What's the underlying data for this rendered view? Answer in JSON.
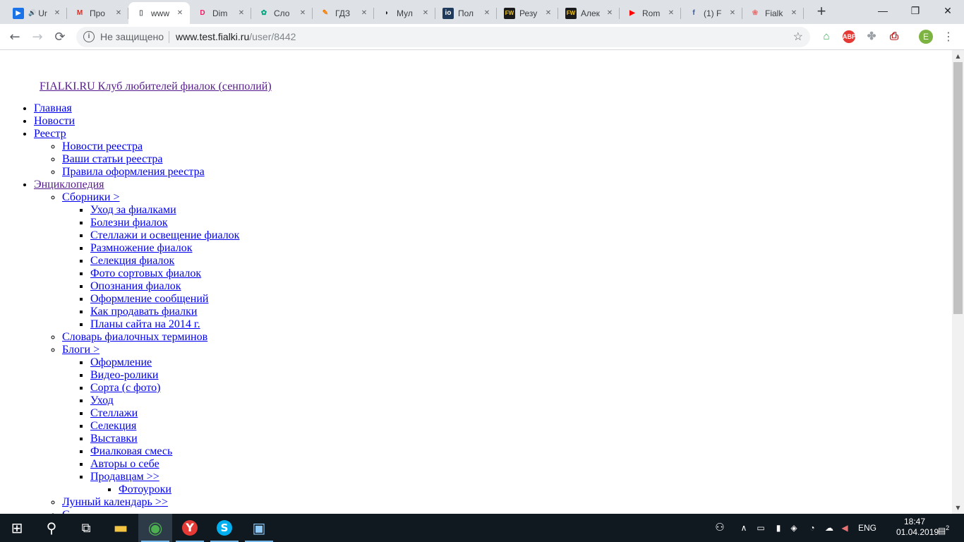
{
  "browser": {
    "tabs": [
      {
        "title": "Ur",
        "icon": "video-play-icon",
        "color": "#1a73e8",
        "glyph": "▶",
        "audio": true
      },
      {
        "title": "Про",
        "icon": "gmail-icon",
        "color": "#d93025",
        "glyph": "M"
      },
      {
        "title": "www",
        "icon": "page-icon",
        "color": "#5f6368",
        "glyph": "▯",
        "active": true
      },
      {
        "title": "Dim",
        "icon": "dim-icon",
        "color": "#e91e63",
        "glyph": "D"
      },
      {
        "title": "Сло",
        "icon": "slo-icon",
        "color": "#00a67e",
        "glyph": "✿"
      },
      {
        "title": "ГДЗ",
        "icon": "pencil-icon",
        "color": "#f57c00",
        "glyph": "✎"
      },
      {
        "title": "Мул",
        "icon": "mul-icon",
        "color": "#202124",
        "glyph": "◗"
      },
      {
        "title": "Пол",
        "icon": "io-icon",
        "color": "#1f3a5a",
        "glyph": "io"
      },
      {
        "title": "Резу",
        "icon": "fw-icon",
        "color": "#1b1b1b",
        "glyph": "FW"
      },
      {
        "title": "Алек",
        "icon": "fw-icon",
        "color": "#1b1b1b",
        "glyph": "FW"
      },
      {
        "title": "Rom",
        "icon": "youtube-icon",
        "color": "#ff0000",
        "glyph": "▶"
      },
      {
        "title": "(1) F",
        "icon": "facebook-icon",
        "color": "#3b5998",
        "glyph": "f"
      },
      {
        "title": "Fialk",
        "icon": "fialki-icon",
        "color": "#e57373",
        "glyph": "❀"
      }
    ],
    "new_tab": "+",
    "window": {
      "minimize": "—",
      "maximize": "❐",
      "close": "✕"
    },
    "nav": {
      "back": "←",
      "forward": "→",
      "reload": "⟳"
    },
    "omnibox": {
      "security": "Не защищено",
      "host": "www.test.fialki.ru",
      "path": "/user/8442",
      "star": "☆"
    },
    "extensions": [
      {
        "name": "home-ext-icon",
        "glyph": "⌂",
        "bg": "#ffffff",
        "fg": "#34a853"
      },
      {
        "name": "adblock-icon",
        "glyph": "ABP",
        "bg": "#e53935",
        "fg": "#ffffff"
      },
      {
        "name": "paw-ext-icon",
        "glyph": "✤",
        "bg": "#ffffff",
        "fg": "#9aa0a6"
      },
      {
        "name": "pdf-ext-icon",
        "glyph": "⎙",
        "bg": "#ffffff",
        "fg": "#b71c1c"
      }
    ],
    "profile_initial": "E",
    "menu": "⋮"
  },
  "page": {
    "site_title": " FIALKI.RU Клуб любителей фиалок (сенполий)",
    "nav": [
      {
        "label": "Главная"
      },
      {
        "label": "Новости"
      },
      {
        "label": "Реестр",
        "children": [
          {
            "label": "Новости реестра"
          },
          {
            "label": "Ваши статьи реестра"
          },
          {
            "label": "Правила оформления реестра"
          }
        ]
      },
      {
        "label": "Энциклопедия",
        "children": [
          {
            "label": "Сборники >",
            "children": [
              {
                "label": "Уход за фиалками"
              },
              {
                "label": "Болезни фиалок"
              },
              {
                "label": "Стеллажи и освещение фиалок"
              },
              {
                "label": "Размножение фиалок"
              },
              {
                "label": "Селекция фиалок"
              },
              {
                "label": "Фото сортовых фиалок"
              },
              {
                "label": "Опознания фиалок"
              },
              {
                "label": "Оформление сообщений"
              },
              {
                "label": "Как продавать фиалки"
              },
              {
                "label": "Планы сайта на 2014 г."
              }
            ]
          },
          {
            "label": "Словарь фиалочных терминов"
          },
          {
            "label": "Блоги >",
            "children": [
              {
                "label": "Оформление"
              },
              {
                "label": "Видео-ролики"
              },
              {
                "label": "Сорта (с фото)"
              },
              {
                "label": "Уход"
              },
              {
                "label": "Стеллажи"
              },
              {
                "label": "Селекция"
              },
              {
                "label": "Выставки"
              },
              {
                "label": "Фиалковая смесь"
              },
              {
                "label": "Авторы о себе"
              },
              {
                "label": "Продавцам >>",
                "children": [
                  {
                    "label": "Фотоуроки"
                  }
                ]
              }
            ]
          },
          {
            "label": "Лунный календарь >>"
          },
          {
            "label": "С..."
          }
        ]
      }
    ]
  },
  "taskbar": {
    "apps": [
      {
        "name": "start-button",
        "glyph": "⊞"
      },
      {
        "name": "search-button",
        "glyph": "⚲"
      },
      {
        "name": "task-view-button",
        "glyph": "⧉"
      },
      {
        "name": "file-explorer-button",
        "glyph": "▬"
      },
      {
        "name": "chrome-button",
        "glyph": "◉",
        "active": true
      },
      {
        "name": "yandex-button",
        "glyph": "Y"
      },
      {
        "name": "skype-button",
        "glyph": "S"
      },
      {
        "name": "photo-app-button",
        "glyph": "▣"
      }
    ],
    "tray": {
      "people": "⚇",
      "chevron": "∧",
      "lang": "ENG",
      "notifications": "2"
    },
    "time": "18:47",
    "date": "01.04.2019"
  }
}
